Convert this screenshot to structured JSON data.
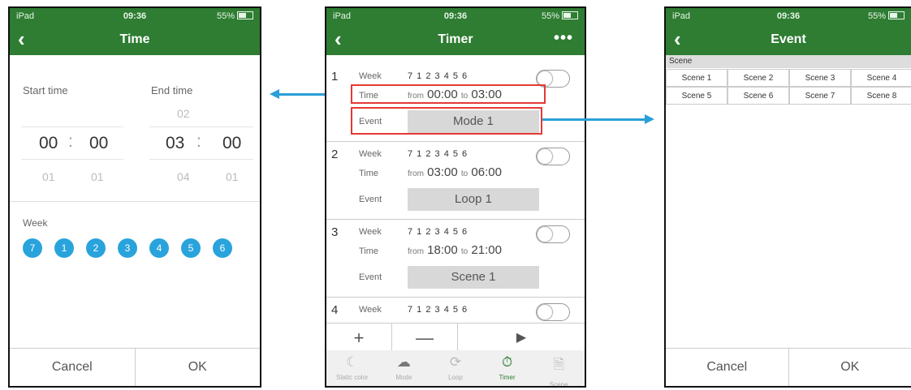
{
  "status": {
    "carrier": "iPad",
    "time": "09:36",
    "battery": "55%"
  },
  "time_screen": {
    "title": "Time",
    "start_label": "Start time",
    "end_label": "End time",
    "start_hour": "00",
    "start_min": "00",
    "start_next_hour": "01",
    "start_next_min": "01",
    "end_prev_hour": "02",
    "end_hour": "03",
    "end_min": "00",
    "end_next_hour": "04",
    "end_next_min": "01",
    "separator": ":",
    "week_label": "Week",
    "week_days": [
      "7",
      "1",
      "2",
      "3",
      "4",
      "5",
      "6"
    ],
    "cancel": "Cancel",
    "ok": "OK"
  },
  "timer_screen": {
    "title": "Timer",
    "week_label": "Week",
    "time_label": "Time",
    "event_label": "Event",
    "from_word": "from",
    "to_word": "to",
    "days": "7 1 2 3 4 5 6",
    "items": [
      {
        "num": "1",
        "from": "00:00",
        "to": "03:00",
        "event": "Mode 1"
      },
      {
        "num": "2",
        "from": "03:00",
        "to": "06:00",
        "event": "Loop 1"
      },
      {
        "num": "3",
        "from": "18:00",
        "to": "21:00",
        "event": "Scene 1"
      },
      {
        "num": "4"
      }
    ],
    "controls": {
      "add": "+",
      "remove": "—",
      "play": "▶"
    },
    "tabs": [
      "Static color",
      "Mode",
      "Loop",
      "Timer",
      "Scene"
    ],
    "active_tab": "Timer"
  },
  "event_screen": {
    "title": "Event",
    "section": "Scene",
    "scenes": [
      "Scene 1",
      "Scene 2",
      "Scene 3",
      "Scene 4",
      "Scene 5",
      "Scene 6",
      "Scene 7",
      "Scene 8"
    ],
    "cancel": "Cancel",
    "ok": "OK"
  },
  "colors": {
    "nav_green": "#2e7d32",
    "accent_blue": "#29a3dc",
    "highlight_red": "#e53935"
  }
}
